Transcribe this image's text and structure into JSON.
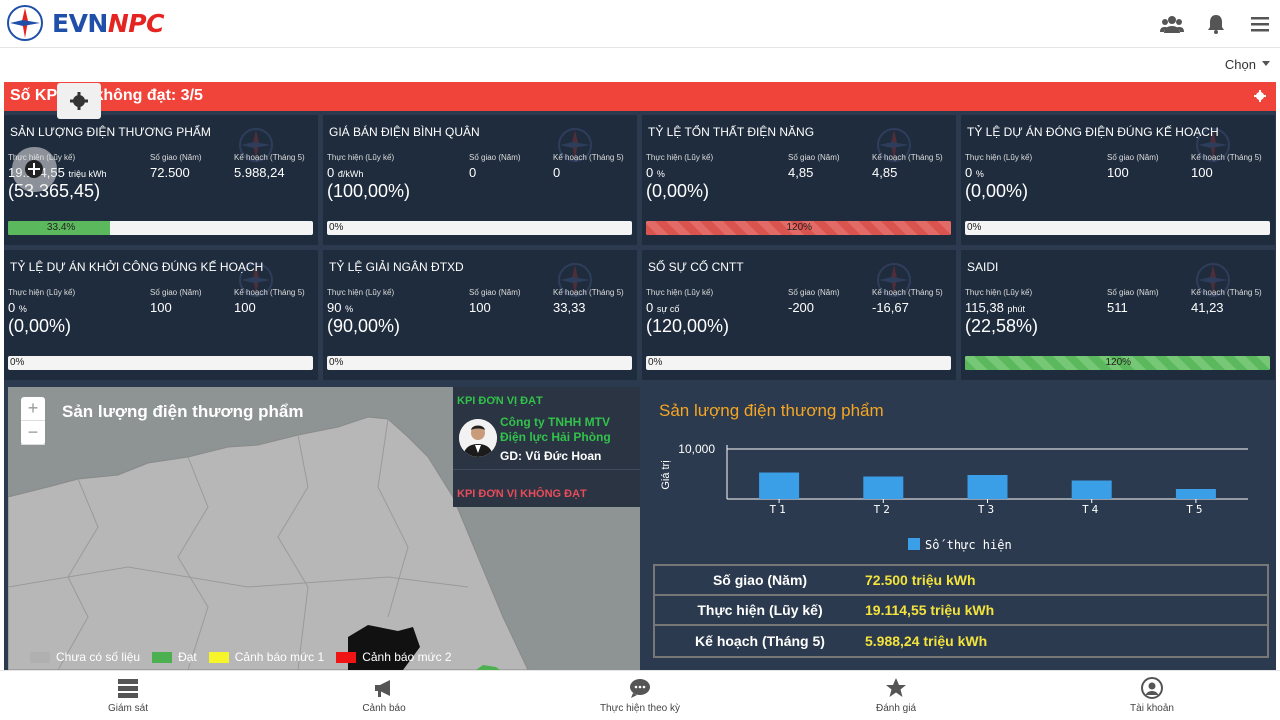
{
  "header": {
    "logo_evn": "EVN",
    "logo_npc": "NPC",
    "icons": [
      "users-icon",
      "bell-icon",
      "menu-icon"
    ],
    "select_label": "Chọn"
  },
  "kpi_bar": {
    "title": "Số KPI đạt/không đạt: 3/5",
    "accent": "#f0443a"
  },
  "labels": {
    "actual": "Thực hiện (Lũy kế)",
    "assigned": "Số giao (Năm)",
    "plan": "Kế hoạch (Tháng 5)"
  },
  "cards": [
    {
      "title": "SẢN LƯỢNG ĐIỆN THƯƠNG PHẨM",
      "actual": "19.114,55",
      "unit": "triệu kWh",
      "assigned": "72.500",
      "plan": "5.988,24",
      "pct": "(53.365,45)",
      "bar_label": "33.4%",
      "bar_value": 0.334,
      "bar_style": "green"
    },
    {
      "title": "GIÁ BÁN ĐIỆN BÌNH QUÂN",
      "actual": "0",
      "unit": "đ/kWh",
      "assigned": "0",
      "plan": "0",
      "pct": "(100,00%)",
      "bar_label": "0%",
      "bar_value": 0,
      "bar_style": "green"
    },
    {
      "title": "TỶ LỆ TỔN THẤT ĐIỆN NĂNG",
      "actual": "0",
      "unit": "%",
      "assigned": "4,85",
      "plan": "4,85",
      "pct": "(0,00%)",
      "bar_label": "120%",
      "bar_value": 1.0,
      "bar_style": "red"
    },
    {
      "title": "TỶ LỆ DỰ ÁN ĐÓNG ĐIỆN ĐÚNG KẾ HOẠCH",
      "actual": "0",
      "unit": "%",
      "assigned": "100",
      "plan": "100",
      "pct": "(0,00%)",
      "bar_label": "0%",
      "bar_value": 0,
      "bar_style": "green"
    },
    {
      "title": "TỶ LỆ DỰ ÁN KHỞI CÔNG ĐÚNG KẾ HOẠCH",
      "actual": "0",
      "unit": "%",
      "assigned": "100",
      "plan": "100",
      "pct": "(0,00%)",
      "bar_label": "0%",
      "bar_value": 0,
      "bar_style": "green"
    },
    {
      "title": "TỶ LỆ GIẢI NGÂN ĐTXD",
      "actual": "90",
      "unit": "%",
      "assigned": "100",
      "plan": "33,33",
      "pct": "(90,00%)",
      "bar_label": "0%",
      "bar_value": 0,
      "bar_style": "green"
    },
    {
      "title": "SỐ SỰ CỐ CNTT",
      "actual": "0",
      "unit": "sự cố",
      "assigned": "-200",
      "plan": "-16,67",
      "pct": "(120,00%)",
      "bar_label": "0%",
      "bar_value": 0,
      "bar_style": "green"
    },
    {
      "title": "SAIDI",
      "actual": "115,38",
      "unit": "phút",
      "assigned": "511",
      "plan": "41,23",
      "pct": "(22,58%)",
      "bar_label": "120%",
      "bar_value": 1.0,
      "bar_style": "gstripe"
    }
  ],
  "map": {
    "title": "Sản lượng điện thương phẩm",
    "zoom_in": "+",
    "zoom_out": "−",
    "legend": [
      {
        "label": "Chưa có số liệu",
        "color": "#b0b0b0"
      },
      {
        "label": "Đạt",
        "color": "#4caf50"
      },
      {
        "label": "Cảnh báo mức 1",
        "color": "#f5f52a"
      },
      {
        "label": "Cảnh báo mức 2",
        "color": "#f01414"
      }
    ]
  },
  "kpi_units": {
    "dat_title": "KPI ĐƠN VỊ ĐẠT",
    "company": "Công ty TNHH MTV Điện lực Hải Phòng",
    "director": "GD: Vũ Đức Hoan",
    "khong_dat_title": "KPI ĐƠN VỊ KHÔNG ĐẠT"
  },
  "chart_data": {
    "type": "bar",
    "title": "Sản lượng điện thương phẩm",
    "ylabel": "Giá trị",
    "xlabel": "",
    "categories": [
      "T1",
      "T2",
      "T3",
      "T4",
      "T5"
    ],
    "series": [
      {
        "name": "Số thực hiện",
        "values": [
          5300,
          4500,
          4800,
          3700,
          2000
        ]
      }
    ],
    "ylim": [
      0,
      10000
    ],
    "yticks": [
      "10,000"
    ],
    "legend": "bottom-center",
    "bar_color": "#3b9fe8",
    "grid": true
  },
  "stats": [
    {
      "key": "Số giao (Năm)",
      "value": "72.500 triệu kWh"
    },
    {
      "key": "Thực hiện (Lũy kế)",
      "value": "19.114,55 triệu kWh"
    },
    {
      "key": "Kế hoạch (Tháng 5)",
      "value": "5.988,24 triệu kWh"
    }
  ],
  "nav": [
    {
      "label": "Giám sát",
      "icon": "server-icon"
    },
    {
      "label": "Cảnh báo",
      "icon": "megaphone-icon"
    },
    {
      "label": "Thực hiện theo kỳ",
      "icon": "chat-icon"
    },
    {
      "label": "Đánh giá",
      "icon": "star-icon"
    },
    {
      "label": "Tài khoản",
      "icon": "account-icon"
    }
  ]
}
